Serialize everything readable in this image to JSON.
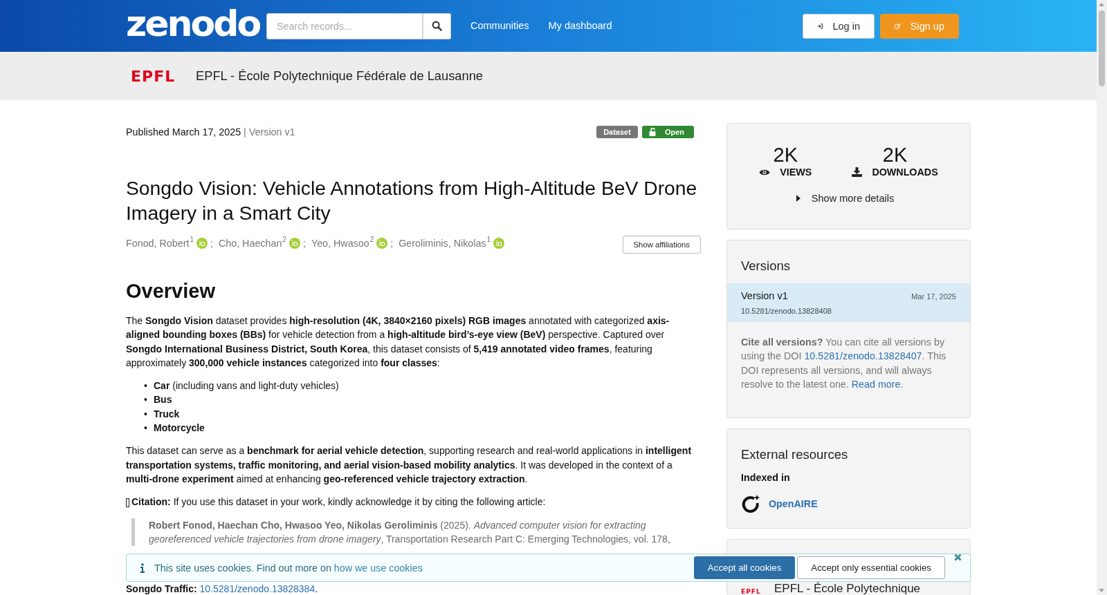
{
  "header": {
    "logo": "zenodo",
    "search": {
      "placeholder": "Search records..."
    },
    "nav": [
      "Communities",
      "My dashboard"
    ],
    "buttons": [
      {
        "label": "Log in",
        "kind": "login"
      },
      {
        "label": "Sign up",
        "kind": "signup"
      }
    ]
  },
  "community": {
    "logo": "EPFL",
    "name": "EPFL - École Polytechnique Fédérale de Lausanne"
  },
  "record": {
    "published": "Published March 17, 2025",
    "version": "| Version v1",
    "badges": [
      {
        "label": "Dataset",
        "kind": "type"
      },
      {
        "label": "Open",
        "kind": "access"
      }
    ],
    "title": "Songdo Vision: Vehicle Annotations from High-Altitude BeV Drone Imagery in a Smart City",
    "authors": [
      {
        "name": "Fonod, Robert",
        "affiliation": "1",
        "separator": ";"
      },
      {
        "name": "Cho, Haechan",
        "affiliation": "2",
        "separator": ";"
      },
      {
        "name": "Yeo, Hwasoo",
        "affiliation": "2",
        "separator": ";"
      },
      {
        "name": "Geroliminis, Nikolas",
        "affiliation": "1"
      }
    ],
    "affiliations_button": "Show affiliations"
  },
  "description": [
    {
      "kind": "heading",
      "text": "Overview"
    },
    {
      "kind": "paragraph",
      "segments": [
        {
          "kind": "text",
          "text": "The **Songdo Vision** dataset provides **high-resolution (4K, 3840×2160 pixels) RGB images** annotated with categorized **axis-aligned bounding boxes (BBs)** for vehicle detection from a **high-altitude bird’s-eye view (BeV)** perspective. Captured over **Songdo International Business District, South Korea**, this dataset consists of **5,419 annotated video frames**, featuring approximately **300,000 vehicle instances** categorized into **four classes**:"
        }
      ]
    },
    {
      "kind": "list",
      "marker": "•",
      "items": [
        "**Car** (including vans and light-duty vehicles)",
        "**Bus**",
        "**Truck**",
        "**Motorcycle**"
      ]
    },
    {
      "kind": "paragraph",
      "segments": [
        {
          "kind": "text",
          "text": "This dataset can serve as a **benchmark for aerial vehicle detection**, supporting research and real-world applications in **intelligent transportation systems, traffic monitoring, and aerial vision-based mobility analytics**. It was developed in the context of a **multi-drone experiment** aimed at enhancing **geo-referenced vehicle trajectory extraction**."
        }
      ]
    },
    {
      "kind": "citation",
      "segments": [
        {
          "kind": "text",
          "text": "**Citation:** If you use this dataset in your work, kindly acknowledge it by citing the following article:"
        }
      ]
    },
    {
      "kind": "quote",
      "segments": [
        {
          "kind": "text",
          "text": "**Robert Fonod, Haechan Cho, Hwasoo Yeo, Nikolas Geroliminis** (2025). *Advanced computer vision for extracting georeferenced vehicle trajectories from drone imagery*, Transportation Research Part C: Emerging Technologies, vol. 178,"
        }
      ]
    },
    {
      "kind": "paragraph",
      "segments": [
        {
          "kind": "text",
          "text": "**Songdo Traffic:** "
        },
        {
          "kind": "link",
          "text": "10.5281/zenodo.13828384"
        },
        {
          "kind": "text",
          "text": "."
        }
      ]
    }
  ],
  "sidebar": {
    "stats": [
      {
        "value": "2K",
        "label": "VIEWS",
        "kind": "views"
      },
      {
        "value": "2K",
        "label": "DOWNLOADS",
        "kind": "downloads"
      }
    ],
    "more_details": "Show more details",
    "versions": {
      "title": "Versions",
      "items": [
        {
          "label": "Version v1",
          "date": "Mar 17, 2025",
          "doi": "10.5281/zenodo.13828408",
          "selected": true
        }
      ],
      "note": [
        {
          "kind": "text",
          "text": "**Cite all versions?** You can cite all versions by using the DOI "
        },
        {
          "kind": "link",
          "text": "10.5281/zenodo.13828407"
        },
        {
          "kind": "text",
          "text": ". This DOI represents all versions, and will always resolve to the latest one. "
        },
        {
          "kind": "link",
          "text": "Read more"
        },
        {
          "kind": "text",
          "text": "."
        }
      ]
    },
    "external": {
      "title": "External resources",
      "subtitle": "Indexed in",
      "items": [
        "OpenAIRE"
      ]
    },
    "communities": [
      {
        "logo": "EPFL",
        "name": "EPFL - École Polytechnique"
      }
    ]
  },
  "cookies": {
    "message": [
      {
        "kind": "text",
        "text": "This site uses cookies. Find out more on "
      },
      {
        "kind": "link",
        "text": "how we use cookies"
      }
    ],
    "buttons": [
      {
        "label": "Accept all cookies",
        "kind": "primary"
      },
      {
        "label": "Accept only essential cookies",
        "kind": "secondary"
      }
    ]
  }
}
